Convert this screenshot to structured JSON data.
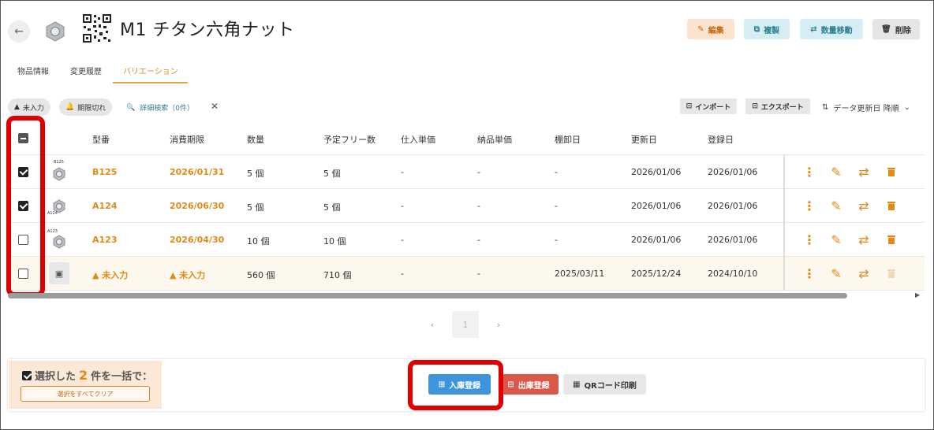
{
  "header": {
    "title": "M1 チタン六角ナット",
    "buttons": {
      "edit": "編集",
      "copy": "複製",
      "move_qty": "数量移動",
      "delete": "削除"
    }
  },
  "tabs": [
    {
      "label": "物品情報",
      "active": false
    },
    {
      "label": "変更履歴",
      "active": false
    },
    {
      "label": "バリエーション",
      "active": true
    }
  ],
  "filters": {
    "chips": [
      "未入力",
      "期限切れ"
    ],
    "advanced_search": "詳細検索（0件）",
    "import": "インポート",
    "export": "エクスポート",
    "sort": "データ更新日 降順"
  },
  "table": {
    "columns": [
      "型番",
      "消費期限",
      "数量",
      "予定フリー数",
      "仕入単価",
      "納品単価",
      "棚卸日",
      "更新日",
      "登録日"
    ],
    "rows": [
      {
        "checked": true,
        "thumb_label": "B125",
        "model": "B125",
        "expiry": "2026/01/31",
        "qty": "5 個",
        "free": "5 個",
        "purchase": "-",
        "delivery": "-",
        "inventory": "-",
        "updated": "2026/01/06",
        "registered": "2026/01/06"
      },
      {
        "checked": true,
        "thumb_label": "A124",
        "model": "A124",
        "expiry": "2026/06/30",
        "qty": "5 個",
        "free": "5 個",
        "purchase": "-",
        "delivery": "-",
        "inventory": "-",
        "updated": "2026/01/06",
        "registered": "2026/01/06"
      },
      {
        "checked": false,
        "thumb_label": "A123",
        "model": "A123",
        "expiry": "2026/04/30",
        "qty": "10 個",
        "free": "10 個",
        "purchase": "-",
        "delivery": "-",
        "inventory": "-",
        "updated": "2026/01/06",
        "registered": "2026/01/06"
      },
      {
        "checked": false,
        "thumb_label": "",
        "model": "未入力",
        "expiry": "未入力",
        "qty": "560 個",
        "free": "710 個",
        "purchase": "-",
        "delivery": "-",
        "inventory": "2025/03/11",
        "updated": "2025/12/24",
        "registered": "2024/10/10"
      }
    ]
  },
  "pagination": {
    "current": "1"
  },
  "bulk": {
    "prefix": "選択した",
    "count": "2",
    "suffix": "件を一括で：",
    "clear": "選択をすべてクリア",
    "stock_in": "入庫登録",
    "stock_out": "出庫登録",
    "qr_print": "QRコード印刷"
  },
  "colors": {
    "accent": "#e08a17",
    "teal": "#2b7f8f",
    "blue": "#3e95dd",
    "red": "#d9584a",
    "highlight": "#e00000"
  }
}
